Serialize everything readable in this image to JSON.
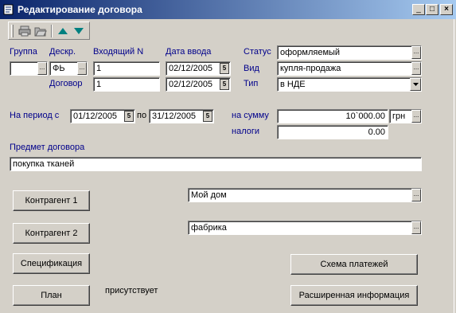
{
  "window": {
    "title": "Редактирование договора",
    "buttons": {
      "minimize": "_",
      "maximize": "□",
      "close": "×"
    }
  },
  "toolbar": {
    "icons": [
      "print-icon",
      "open-folder-icon",
      "arrow-up-icon",
      "arrow-down-icon"
    ]
  },
  "labels": {
    "group": "Группа",
    "descr": "Дескр.",
    "incoming_no": "Входящий N",
    "entry_date": "Дата ввода",
    "status": "Статус",
    "kind": "Вид",
    "contract": "Договор",
    "type": "Тип",
    "period_from": "На период с",
    "period_to": "по",
    "amount": "на сумму",
    "taxes": "налоги",
    "subject": "Предмет договора"
  },
  "fields": {
    "group": "",
    "descr": "ФЬ",
    "incoming_no": "1",
    "contract_no": "1",
    "entry_date": "02/12/2005",
    "contract_date": "02/12/2005",
    "status": "оформляемый",
    "kind": "купля-продажа",
    "type": "в НДЕ",
    "period_from": "01/12/2005",
    "period_to": "31/12/2005",
    "amount": "10`000.00",
    "currency": "грн",
    "taxes": "0.00",
    "subject": "покупка тканей",
    "counterparty1": "Мой дом",
    "counterparty2": "фабрика"
  },
  "buttons": {
    "counterparty1": "Контрагент 1",
    "counterparty2": "Контрагент 2",
    "specification": "Спецификация",
    "plan": "План",
    "payment_scheme": "Схема платежей",
    "extended_info": "Расширенная информация"
  },
  "plan_status": "присутствует",
  "colors": {
    "title_start": "#0a246a",
    "title_end": "#a6caf0",
    "label_blue": "#00008b",
    "face": "#d4d0c8"
  }
}
